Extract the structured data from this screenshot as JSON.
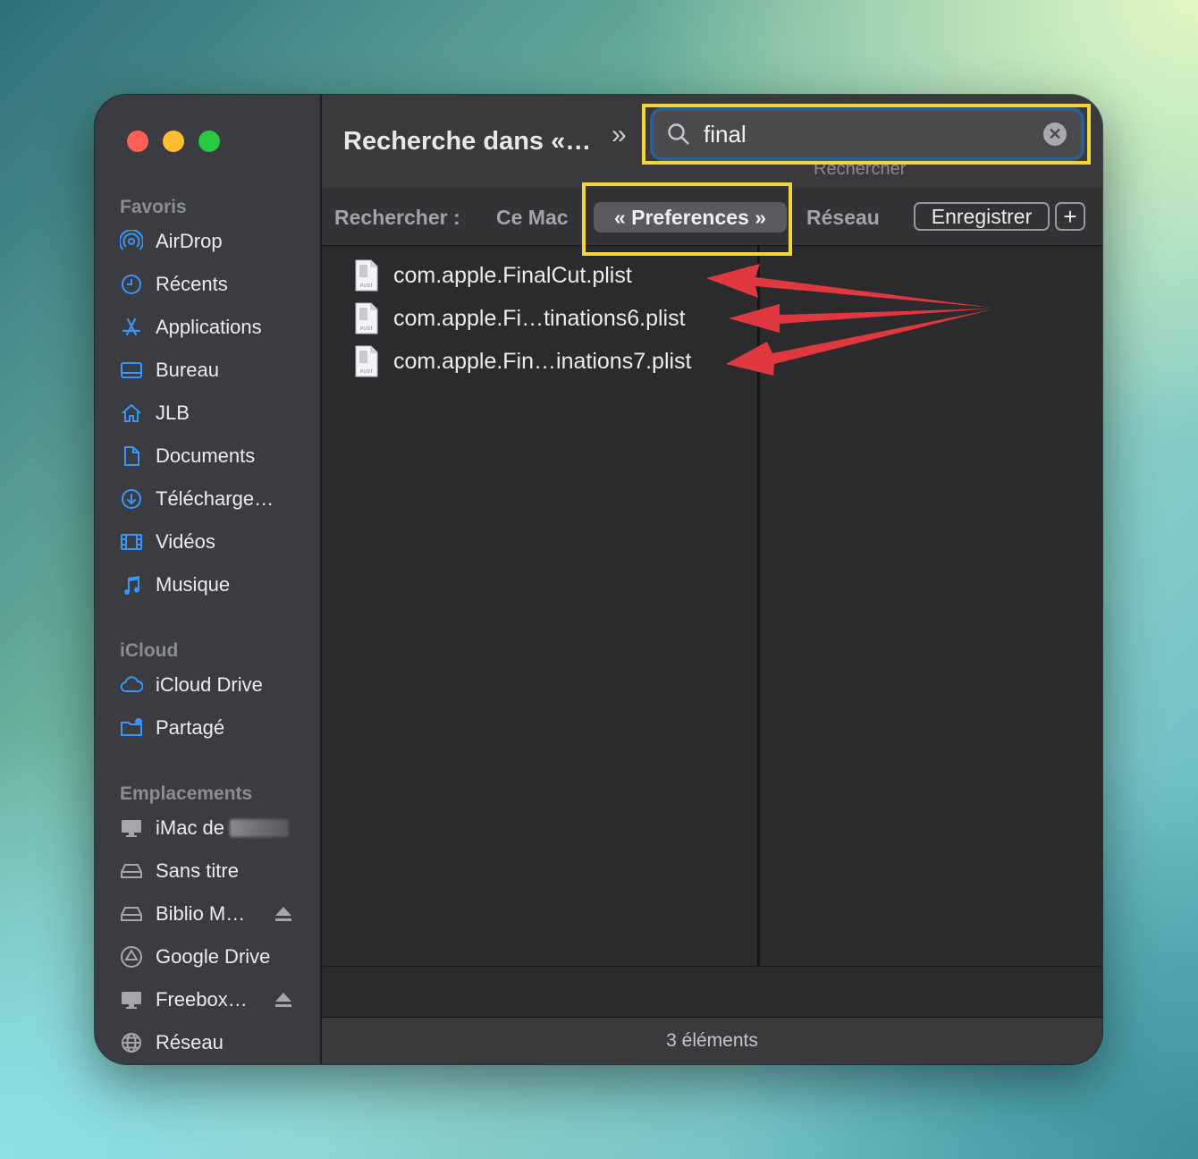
{
  "window": {
    "title": "Recherche dans «…",
    "search": {
      "value": "final",
      "placeholder": "Rechercher",
      "hint": "Rechercher"
    }
  },
  "sidebar": {
    "favoris_title": "Favoris",
    "favoris": [
      {
        "label": "AirDrop",
        "icon": "airdrop-icon"
      },
      {
        "label": "Récents",
        "icon": "clock-icon"
      },
      {
        "label": "Applications",
        "icon": "applications-icon"
      },
      {
        "label": "Bureau",
        "icon": "desktop-icon"
      },
      {
        "label": "JLB",
        "icon": "home-icon"
      },
      {
        "label": "Documents",
        "icon": "document-icon"
      },
      {
        "label": "Télécharge…",
        "icon": "download-icon"
      },
      {
        "label": "Vidéos",
        "icon": "film-icon"
      },
      {
        "label": "Musique",
        "icon": "music-icon"
      }
    ],
    "icloud_title": "iCloud",
    "icloud": [
      {
        "label": "iCloud Drive",
        "icon": "cloud-icon"
      },
      {
        "label": "Partagé",
        "icon": "shared-folder-icon"
      }
    ],
    "emplacements_title": "Emplacements",
    "emplacements": [
      {
        "label": "iMac de",
        "icon": "imac-icon"
      },
      {
        "label": "Sans titre",
        "icon": "drive-icon"
      },
      {
        "label": "Biblio M…",
        "icon": "drive-icon"
      },
      {
        "label": "Google Drive",
        "icon": "google-drive-icon"
      },
      {
        "label": "Freebox…",
        "icon": "monitor-icon"
      },
      {
        "label": "Réseau",
        "icon": "globe-icon"
      }
    ]
  },
  "scope": {
    "label": "Rechercher :",
    "options": [
      "Ce Mac",
      "« Preferences »",
      "Réseau"
    ],
    "selected": "« Preferences »",
    "save": "Enregistrer",
    "add": "+"
  },
  "results": [
    {
      "name": "com.apple.FinalCut.plist"
    },
    {
      "name": "com.apple.Fi…tinations6.plist"
    },
    {
      "name": "com.apple.Fin…inations7.plist"
    }
  ],
  "status": {
    "text": "3 éléments"
  },
  "colors": {
    "highlight": "#f2d43b",
    "arrow": "#e0383e",
    "accent": "#2b5f93"
  },
  "plist_icon_label": "PLIST"
}
